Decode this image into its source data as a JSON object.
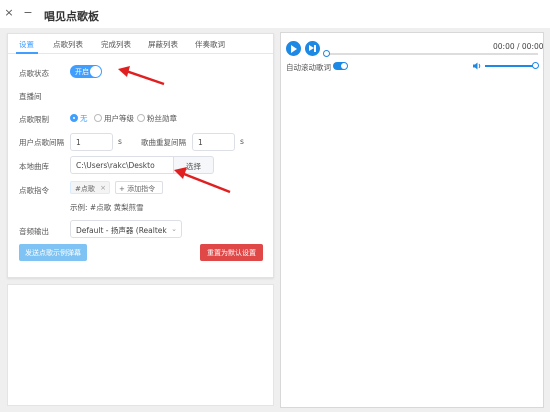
{
  "window": {
    "close_glyph": "×",
    "minimize_glyph": "−",
    "title": "唱见点歌板"
  },
  "tabs": [
    {
      "label": "设置",
      "active": true
    },
    {
      "label": "点歌列表",
      "active": false
    },
    {
      "label": "完成列表",
      "active": false
    },
    {
      "label": "屏蔽列表",
      "active": false
    },
    {
      "label": "伴奏歌词",
      "active": false
    }
  ],
  "settings": {
    "song_status": {
      "label": "点歌状态",
      "switch_text": "开启",
      "on": true
    },
    "live_room": {
      "label": "直播间"
    },
    "song_limit": {
      "label": "点歌限制",
      "options": [
        {
          "label": "无",
          "checked": true
        },
        {
          "label": "用户等级",
          "checked": false
        },
        {
          "label": "粉丝勋章",
          "checked": false
        }
      ]
    },
    "user_interval": {
      "label": "用户点歌间隔",
      "value": "1",
      "unit": "s"
    },
    "repeat_interval": {
      "label": "歌曲重复间隔",
      "value": "1",
      "unit": "s"
    },
    "local_library": {
      "label": "本地曲库",
      "path": "C:\\Users\\rakc\\Deskto",
      "button": "选择"
    },
    "command": {
      "label": "点歌指令",
      "tag": "#点歌",
      "tag_close": "×",
      "add_label": "+ 添加指令",
      "example": "示例: #点歌 黄梨煎雪"
    },
    "audio_output": {
      "label": "音频输出",
      "value": "Default - 扬声器 (Realtek",
      "chevron": "⌄"
    },
    "send_button": "发送点歌示例弹幕",
    "reset_button": "重置为默认设置"
  },
  "player": {
    "time": "00:00 / 00:00",
    "auto_scroll_label": "自动滚动歌词",
    "auto_scroll_on": true,
    "progress": 0,
    "volume": 1.0
  },
  "colors": {
    "accent": "#409eff",
    "player_blue": "#1e88e5",
    "reset_red": "#e04848",
    "send_blue": "#7ec3f4",
    "annotation_arrow": "#e02020"
  },
  "icons": [
    "play-icon",
    "next-icon",
    "volume-icon",
    "close-icon",
    "minimize-icon",
    "chevron-down-icon"
  ]
}
